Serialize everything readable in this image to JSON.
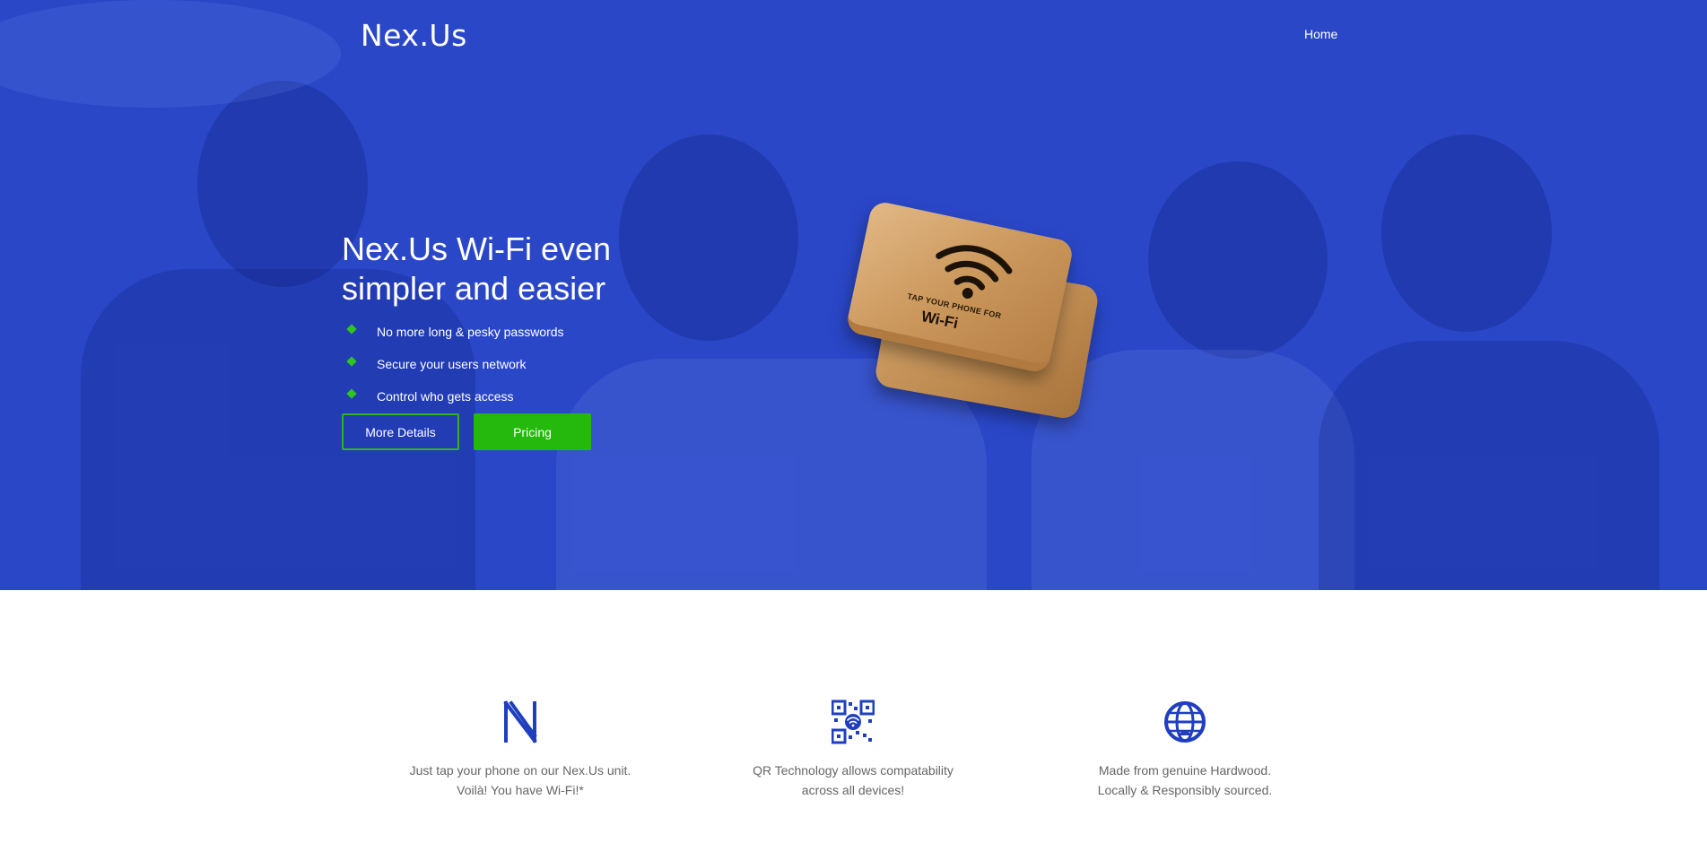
{
  "brand": {
    "logo_text": "Nex.Us"
  },
  "nav": {
    "home_label": "Home"
  },
  "hero": {
    "headline": "Nex.Us Wi-Fi even simpler and easier",
    "features": [
      "No more long & pesky passwords",
      "Secure your users network",
      "Control who gets access"
    ],
    "more_details_label": "More Details",
    "pricing_label": "Pricing",
    "product": {
      "tap_text": "TAP YOUR PHONE FOR",
      "wifi_word": "Wi-Fi"
    }
  },
  "features": [
    {
      "icon": "nexus-n-icon",
      "line1": "Just tap your phone on our Nex.Us unit.",
      "line2": "Voilà! You have Wi-Fi!*"
    },
    {
      "icon": "qr-code-icon",
      "line1": "QR Technology allows compatability",
      "line2": "across all devices!"
    },
    {
      "icon": "globe-icon",
      "line1": "Made from genuine Hardwood.",
      "line2": "Locally & Responsibly sourced."
    }
  ],
  "colors": {
    "hero_blue": "#2a47c8",
    "accent_green": "#24b90c",
    "icon_blue": "#1f3fbf",
    "body_text": "#666666"
  }
}
